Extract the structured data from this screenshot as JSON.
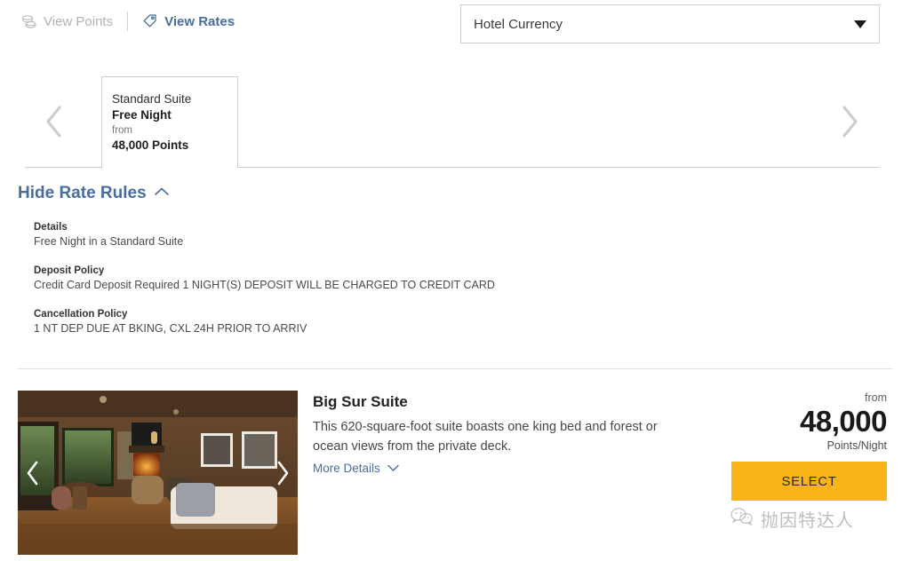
{
  "topbar": {
    "view_points": {
      "label": "View Points",
      "icon": "coins-stack-icon",
      "active": false
    },
    "view_rates": {
      "label": "View Rates",
      "icon": "price-tag-icon",
      "active": true
    },
    "currency_select": {
      "value": "Hotel Currency",
      "icon": "chevron-down-icon"
    }
  },
  "rate_carousel": {
    "prev_icon": "chevron-left-icon",
    "next_icon": "chevron-right-icon",
    "selected_card": {
      "line1": "Standard Suite",
      "line2": "Free Night",
      "from_label": "from",
      "points": "48,000 Points"
    }
  },
  "rate_rules": {
    "toggle_label": "Hide Rate Rules",
    "toggle_icon": "chevron-up-icon",
    "blocks": [
      {
        "heading": "Details",
        "text": "Free Night in a Standard Suite"
      },
      {
        "heading": "Deposit Policy",
        "text": "Credit Card Deposit Required 1 NIGHT(S) DEPOSIT WILL BE CHARGED TO CREDIT CARD"
      },
      {
        "heading": "Cancellation Policy",
        "text": "1 NT DEP DUE AT BKING, CXL 24H PRIOR TO ARRIV"
      }
    ]
  },
  "room": {
    "photo": {
      "alt": "hotel-room-interior-photo",
      "prev_icon": "chevron-left-icon",
      "next_icon": "chevron-right-icon"
    },
    "title": "Big Sur Suite",
    "description": "This 620-square-foot suite boasts one king bed and forest or ocean views from the private deck.",
    "more_details_label": "More Details",
    "more_details_icon": "chevron-down-icon",
    "price": {
      "from_label": "from",
      "amount": "48,000",
      "unit": "Points/Night"
    },
    "select_label": "SELECT"
  },
  "watermark": {
    "icon": "wechat-icon",
    "text": "抛因特达人"
  },
  "colors": {
    "accent_blue": "#4a6d9c",
    "select_button": "#fab418",
    "muted_gray": "#b2b2b2",
    "border": "#cfcfcf"
  }
}
